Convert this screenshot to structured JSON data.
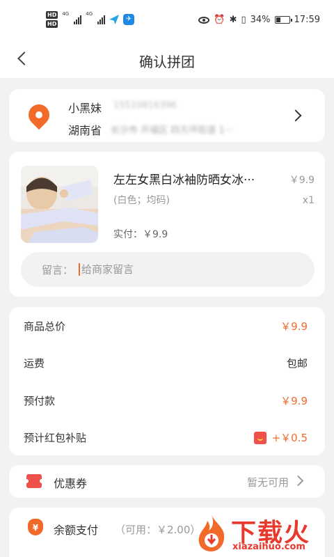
{
  "status_bar": {
    "hd1": "HD",
    "hd2": "HD",
    "net1": "4G",
    "net2": "4G",
    "battery": "34%",
    "time": "17:59"
  },
  "nav": {
    "title": "确认拼团"
  },
  "address": {
    "name": "小黑妹",
    "phone": "15510816396",
    "province": "湖南省",
    "detail": "长沙市 开福区 四方坪街道 1···"
  },
  "product": {
    "title": "左左女黑白冰袖防晒女冰···",
    "price": "￥9.9",
    "spec": "(白色；均码)",
    "quantity": "x1",
    "paid_label": "实付：",
    "paid_value": "￥9.9",
    "message_label": "留言：",
    "message_placeholder": "给商家留言"
  },
  "pricing": {
    "rows": [
      {
        "label": "商品总价",
        "value": "￥9.9"
      },
      {
        "label": "运费",
        "value": "包邮"
      },
      {
        "label": "预付款",
        "value": "￥9.9"
      },
      {
        "label": "预计红包补贴",
        "value": "+￥0.5"
      }
    ]
  },
  "coupon": {
    "label": "优惠券",
    "value": "暂无可用"
  },
  "balance": {
    "label": "余额支付",
    "available": "（可用：￥2.00）"
  },
  "watermark": {
    "text": "下载火",
    "url": "xiazaihuo.com"
  },
  "colors": {
    "accent": "#f26a2a",
    "red": "#f0504a",
    "background": "#f2f2f2"
  }
}
